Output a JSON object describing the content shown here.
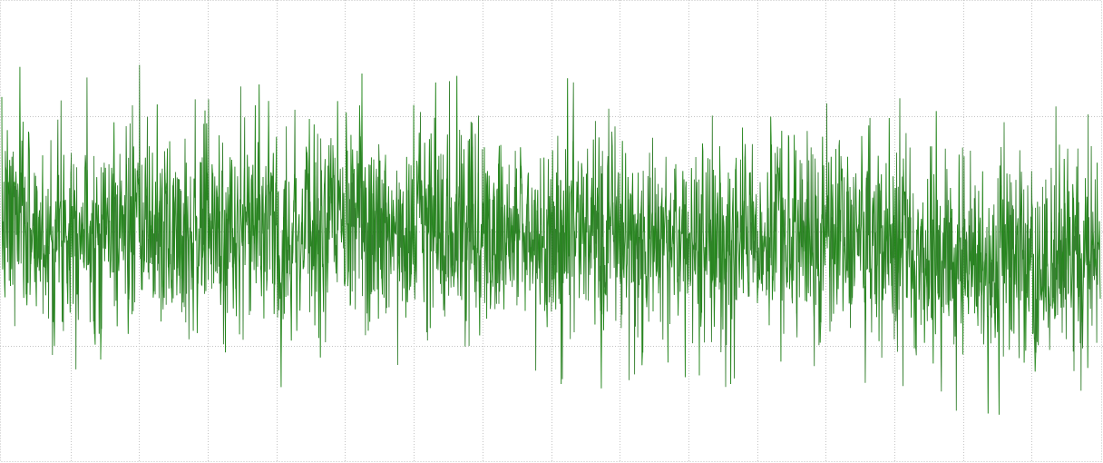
{
  "chart_data": {
    "type": "line",
    "title": "",
    "xlabel": "",
    "ylabel": "",
    "x_range": [
      0,
      16
    ],
    "y_range": [
      -1,
      1
    ],
    "x_gridlines": [
      1,
      2,
      3,
      4,
      5,
      6,
      7,
      8,
      9,
      10,
      11,
      12,
      13,
      14,
      15
    ],
    "y_gridlines": [
      -0.5,
      0,
      0.5
    ],
    "grid": true,
    "grid_style": "dotted",
    "legend": "none",
    "series": [
      {
        "color": "#1a8a10",
        "fill_color": "#136b0c",
        "samples_per_unit": 175,
        "envelope": {
          "x": [
            0.0,
            0.25,
            0.45,
            0.5,
            0.75,
            1.0,
            1.25,
            1.5,
            1.75,
            2.0,
            2.25,
            2.4,
            2.6,
            2.75,
            3.0,
            3.25,
            3.5,
            3.75,
            4.0,
            4.25,
            4.5,
            4.75,
            5.0,
            5.25,
            5.5,
            5.6,
            5.75,
            6.0,
            6.25,
            6.5,
            6.75,
            7.0,
            7.25,
            7.5,
            7.75,
            8.0,
            8.25,
            8.5,
            8.75,
            9.0,
            9.25,
            9.5,
            9.75,
            10.0,
            10.25,
            10.5,
            10.75,
            11.0,
            11.25,
            11.5,
            11.75,
            12.0,
            12.25,
            12.5,
            12.75,
            13.0,
            13.25,
            13.5,
            13.75,
            14.0,
            14.25,
            14.5,
            14.75,
            15.0,
            15.25,
            15.5,
            15.75,
            16.0
          ],
          "upper": [
            0.55,
            0.63,
            0.56,
            0.48,
            0.58,
            0.64,
            0.58,
            0.6,
            0.56,
            0.63,
            0.56,
            0.5,
            0.6,
            0.61,
            0.6,
            0.56,
            0.6,
            0.58,
            0.56,
            0.6,
            0.58,
            0.56,
            0.55,
            0.6,
            0.6,
            0.52,
            0.57,
            0.63,
            0.58,
            0.6,
            0.58,
            0.55,
            0.57,
            0.56,
            0.55,
            0.56,
            0.58,
            0.52,
            0.54,
            0.55,
            0.5,
            0.54,
            0.55,
            0.56,
            0.55,
            0.54,
            0.52,
            0.5,
            0.55,
            0.56,
            0.55,
            0.54,
            0.55,
            0.54,
            0.55,
            0.52,
            0.5,
            0.45,
            0.48,
            0.45,
            0.48,
            0.47,
            0.5,
            0.48,
            0.5,
            0.48,
            0.5,
            0.48
          ],
          "lower": [
            -0.5,
            -0.55,
            -0.48,
            -0.56,
            -0.62,
            -0.5,
            -0.55,
            -0.56,
            -0.5,
            -0.62,
            -0.55,
            -0.58,
            -0.52,
            -0.6,
            -0.54,
            -0.62,
            -0.55,
            -0.5,
            -0.58,
            -0.62,
            -0.55,
            -0.56,
            -0.5,
            -0.56,
            -0.6,
            -0.55,
            -0.5,
            -0.52,
            -0.6,
            -0.55,
            -0.52,
            -0.55,
            -0.58,
            -0.55,
            -0.56,
            -0.62,
            -0.55,
            -0.58,
            -0.6,
            -0.55,
            -0.58,
            -0.62,
            -0.56,
            -0.55,
            -0.58,
            -0.6,
            -0.56,
            -0.55,
            -0.6,
            -0.58,
            -0.62,
            -0.58,
            -0.55,
            -0.6,
            -0.66,
            -0.7,
            -0.72,
            -0.75,
            -0.68,
            -0.72,
            -0.7,
            -0.72,
            -0.68,
            -0.72,
            -0.74,
            -0.72,
            -0.7,
            -0.7
          ]
        },
        "seed": 7
      }
    ]
  }
}
